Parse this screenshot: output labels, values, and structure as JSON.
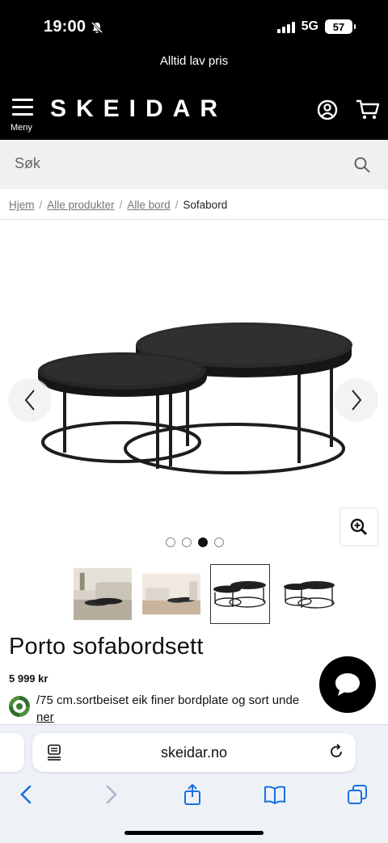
{
  "status_bar": {
    "time": "19:00",
    "network": "5G",
    "battery": "57"
  },
  "promo": {
    "text": "Alltid lav pris"
  },
  "header": {
    "menu_label": "Meny",
    "logo": "SKEIDAR"
  },
  "search": {
    "placeholder": "Søk"
  },
  "breadcrumb": {
    "items": [
      "Hjem",
      "Alle produkter",
      "Alle bord"
    ],
    "current": "Sofabord",
    "separator": "/"
  },
  "gallery": {
    "image_count": 4,
    "active_index": 2
  },
  "product": {
    "title": "Porto sofabordsett",
    "price": "5 999 kr",
    "description": "/75 cm.sortbeiset eik finer bordplate og sort unde",
    "description_more": "ner"
  },
  "browser": {
    "url": "skeidar.no"
  },
  "colors": {
    "header_bg": "#000000",
    "search_bg": "#f0f0f0",
    "safari_bg": "#eef2f7"
  }
}
